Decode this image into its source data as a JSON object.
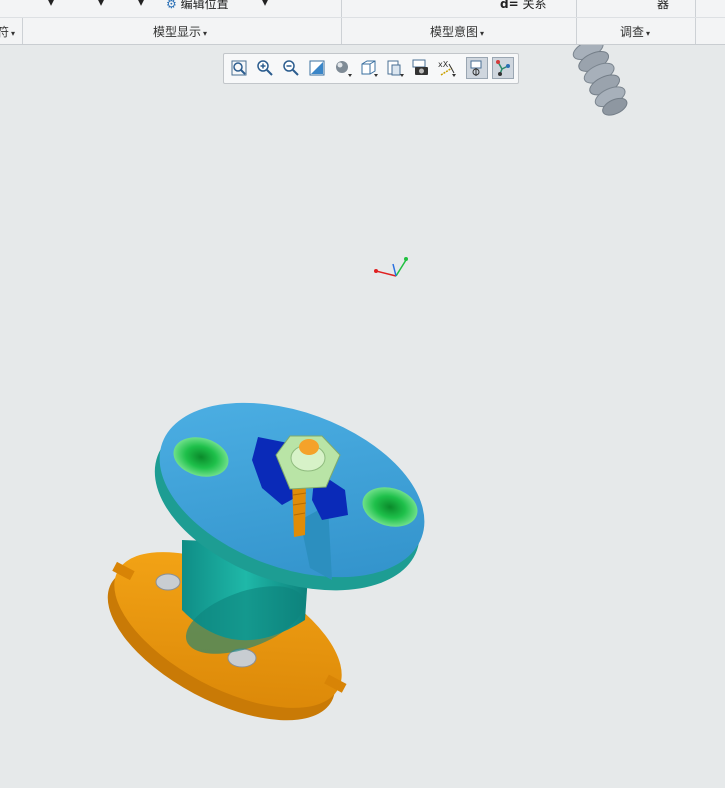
{
  "ribbon": {
    "top_items": [
      "编辑位置",
      "关系",
      "器"
    ],
    "top_prefix_d": "d=",
    "groups": [
      {
        "label": "符"
      },
      {
        "label": "模型显示"
      },
      {
        "label": "模型意图"
      },
      {
        "label": "调查"
      }
    ]
  },
  "graphics_toolbar": {
    "buttons": [
      "refit-icon",
      "zoom-in-icon",
      "zoom-out-icon",
      "repaint-icon",
      "display-style-icon",
      "saved-orientations-icon",
      "view-manager-icon",
      "perspective-camera-icon",
      "datum-display-filter-icon",
      "spin-center-icon",
      "annotation-display-icon"
    ]
  },
  "colors": {
    "background": "#e6e9ea",
    "flange_blue": "#3aa0d8",
    "body_teal": "#1aa59a",
    "base_orange": "#f09a12",
    "spring_gray": "#9aa3ad"
  }
}
